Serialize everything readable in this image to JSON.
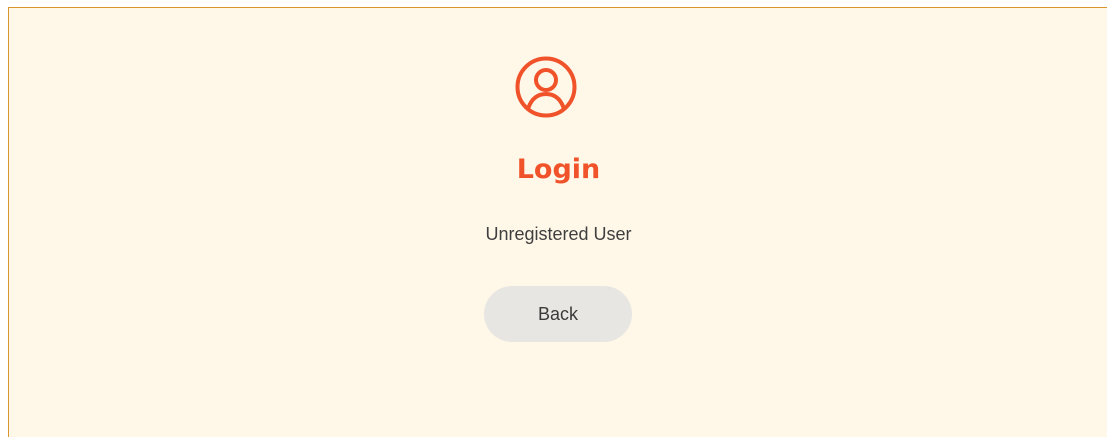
{
  "login": {
    "icon": "user-circle-icon",
    "title": "Login",
    "message": "Unregistered User",
    "back_label": "Back"
  },
  "colors": {
    "accent": "#f0522a",
    "panel_background": "#fff8e9",
    "panel_border": "#d9962f",
    "button_background": "#e8e6e2"
  }
}
